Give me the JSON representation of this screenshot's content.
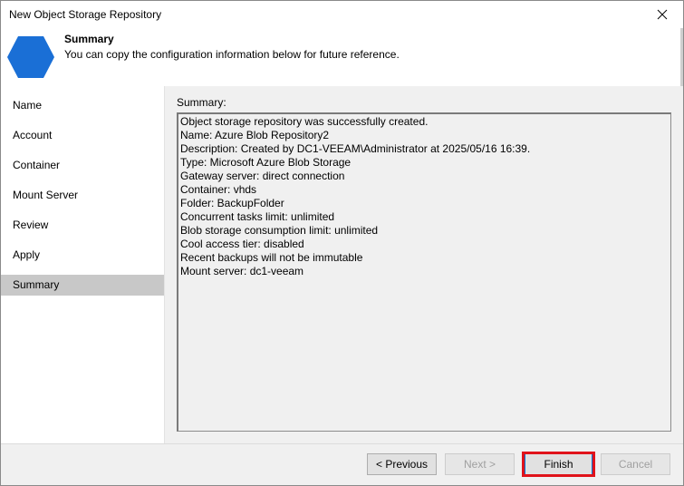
{
  "window": {
    "title": "New Object Storage Repository"
  },
  "header": {
    "title": "Summary",
    "subtitle": "You can copy the configuration information below for future reference.",
    "icon": "hexagon-icon",
    "icon_color": "#1a6fd6"
  },
  "nav": {
    "items": [
      {
        "label": "Name"
      },
      {
        "label": "Account"
      },
      {
        "label": "Container"
      },
      {
        "label": "Mount Server"
      },
      {
        "label": "Review"
      },
      {
        "label": "Apply"
      },
      {
        "label": "Summary",
        "active": true
      }
    ]
  },
  "content": {
    "label": "Summary:",
    "lines": [
      "Object storage repository was successfully created.",
      "Name: Azure Blob Repository2",
      "Description: Created by DC1-VEEAM\\Administrator at 2025/05/16 16:39.",
      "Type: Microsoft Azure Blob Storage",
      "Gateway server: direct connection",
      "Container: vhds",
      "Folder: BackupFolder",
      "Concurrent tasks limit: unlimited",
      "Blob storage consumption limit: unlimited",
      "Cool access tier: disabled",
      "Recent backups will not be immutable",
      "Mount server: dc1-veeam"
    ]
  },
  "buttons": {
    "previous": "< Previous",
    "next": "Next >",
    "finish": "Finish",
    "cancel": "Cancel"
  },
  "colors": {
    "highlight": "#e0131b",
    "accent": "#0078d7",
    "active_nav": "#c8c8c8"
  }
}
